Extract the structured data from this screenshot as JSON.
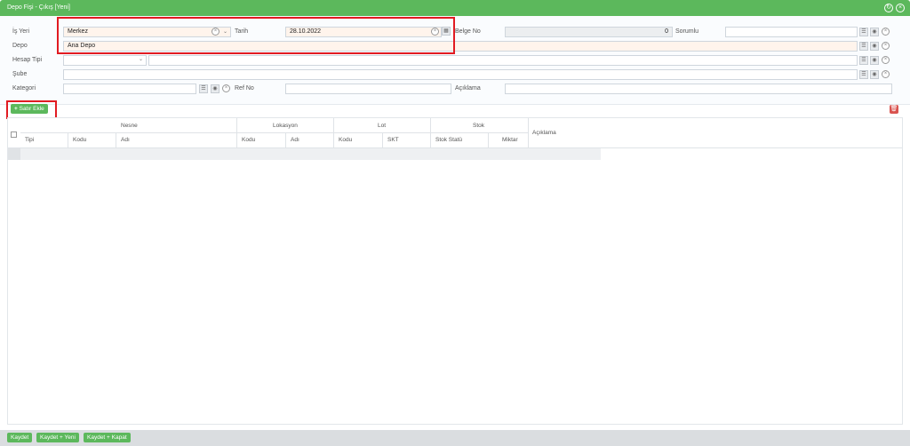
{
  "window": {
    "title": "Depo Fişi - Çıkış [Yeni]",
    "refresh_icon": "refresh-icon",
    "close_icon": "close-icon"
  },
  "form": {
    "is_yeri": {
      "label": "İş Yeri",
      "value": "Merkez"
    },
    "tarih": {
      "label": "Tarih",
      "value": "28.10.2022"
    },
    "belge_no": {
      "label": "Belge No",
      "value": "0"
    },
    "sorumlu": {
      "label": "Sorumlu",
      "value": ""
    },
    "depo": {
      "label": "Depo",
      "value": "Ana Depo"
    },
    "hesap_tipi": {
      "label": "Hesap Tipi",
      "value": ""
    },
    "sube": {
      "label": "Şube",
      "value": ""
    },
    "kategori": {
      "label": "Kategori",
      "value": ""
    },
    "ref_no": {
      "label": "Ref No",
      "value": ""
    },
    "aciklama": {
      "label": "Açıklama",
      "value": ""
    }
  },
  "toolbar": {
    "add_row_label": "Satır Ekle",
    "add_row_icon": "plus-icon",
    "delete_icon": "trash-icon"
  },
  "grid": {
    "groups": {
      "nesne": "Nesne",
      "lokasyon": "Lokasyon",
      "lot": "Lot",
      "stok": "Stok"
    },
    "columns": {
      "tipi": "Tipi",
      "nesne_kodu": "Kodu",
      "nesne_adi": "Adı",
      "lok_kodu": "Kodu",
      "lok_adi": "Adı",
      "lot_kodu": "Kodu",
      "skt": "SKT",
      "stok_statu": "Stok Statü",
      "miktar": "Miktar",
      "aciklama": "Açıklama"
    }
  },
  "footer": {
    "kaydet": "Kaydet",
    "kaydet_yeni": "Kaydet + Yeni",
    "kaydet_kapat": "Kaydet + Kapat"
  },
  "colors": {
    "accent": "#5cb85c",
    "highlight": "#e11b22",
    "danger": "#d9534f"
  }
}
